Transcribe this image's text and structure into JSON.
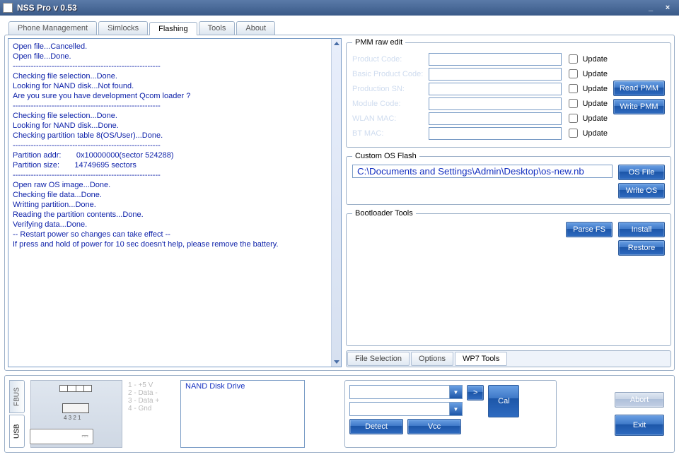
{
  "window": {
    "title": "NSS Pro v 0.53"
  },
  "tabs": [
    "Phone Management",
    "Simlocks",
    "Flashing",
    "Tools",
    "About"
  ],
  "active_tab": "Flashing",
  "log": "Open file...Cancelled.\nOpen file...Done.\n---------------------------------------------------------\nChecking file selection...Done.\nLooking for NAND disk...Not found.\nAre you sure you have development Qcom loader ?\n---------------------------------------------------------\nChecking file selection...Done.\nLooking for NAND disk...Done.\nChecking partition table 8(OS/User)...Done.\n---------------------------------------------------------\nPartition addr:       0x10000000(sector 524288)\nPartition size:       14749695 sectors\n---------------------------------------------------------\nOpen raw OS image...Done.\nChecking file data...Done.\nWritting partition...Done.\nReading the partition contents...Done.\nVerifying data...Done.\n-- Restart power so changes can take effect --\nIf press and hold of power for 10 sec doesn't help, please remove the battery.",
  "pmm": {
    "legend": "PMM raw edit",
    "rows": [
      {
        "label": "Product Code:",
        "update": "Update"
      },
      {
        "label": "Basic Product Code:",
        "update": "Update"
      },
      {
        "label": "Production SN:",
        "update": "Update"
      },
      {
        "label": "Module Code:",
        "update": "Update"
      },
      {
        "label": "WLAN MAC:",
        "update": "Update"
      },
      {
        "label": "BT MAC:",
        "update": "Update"
      }
    ],
    "read_btn": "Read PMM",
    "write_btn": "Write PMM"
  },
  "osflash": {
    "legend": "Custom OS Flash",
    "path": "C:\\Documents and Settings\\Admin\\Desktop\\os-new.nb",
    "file_btn": "OS File",
    "write_btn": "Write OS"
  },
  "bootloader": {
    "legend": "Bootloader Tools",
    "parse_btn": "Parse FS",
    "install_btn": "Install",
    "restore_btn": "Restore"
  },
  "inner_tabs": [
    "File Selection",
    "Options",
    "WP7 Tools"
  ],
  "inner_active": "WP7 Tools",
  "side_tabs": [
    "FBUS",
    "USB"
  ],
  "side_active": "USB",
  "pins": [
    "1 - +5 V",
    "2 - Data -",
    "3 - Data +",
    "4 - Gnd"
  ],
  "pin_label_4321": "4 3 2 1",
  "nand_label": "NAND Disk Drive",
  "detect": {
    "go_btn": ">",
    "detect_btn": "Detect",
    "vcc_btn": "Vcc",
    "cal_btn": "Cal"
  },
  "abort_btn": "Abort",
  "exit_btn": "Exit"
}
